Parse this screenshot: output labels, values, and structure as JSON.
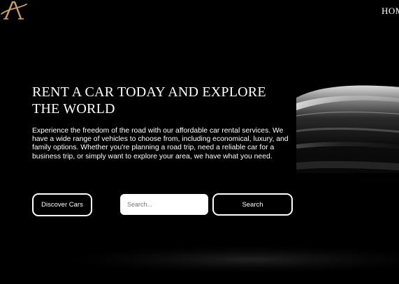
{
  "header": {
    "logo_letter": "A",
    "nav": {
      "home_label": "HOM"
    }
  },
  "hero": {
    "title": "RENT A CAR TODAY AND EXPLORE THE WORLD",
    "description": "Experience the freedom of the road with our affordable car rental services. We have a wide range of vehicles to choose from, including economical, luxury, and family options. Whether you're planning a road trip, need a reliable car for a business trip, or simply want to explore your area, we have what you need."
  },
  "actions": {
    "discover_label": "Discover Cars",
    "search_placeholder": "Search...",
    "search_value": "",
    "search_button_label": "Search"
  },
  "colors": {
    "background": "#000000",
    "text": "#ffffff",
    "logo_gold": "#c9a15a"
  },
  "icons": {
    "logo": "brand-a-logo",
    "hero_image": "car-silhouette-image"
  }
}
